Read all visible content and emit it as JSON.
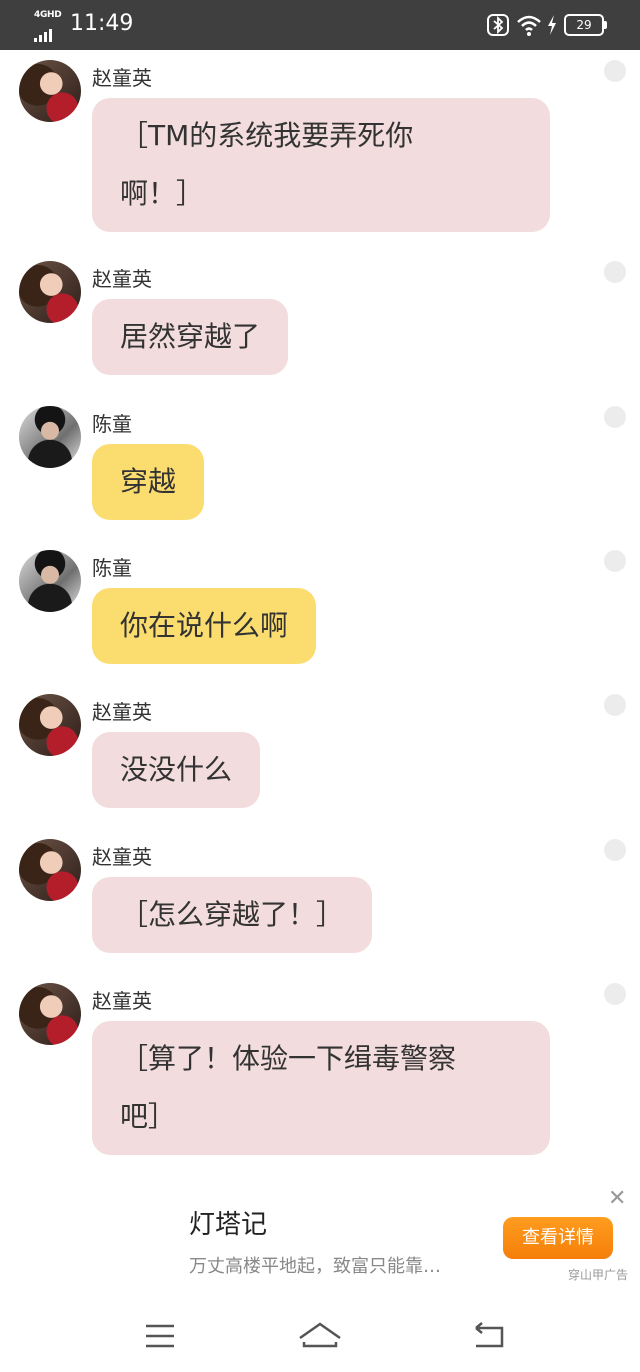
{
  "status_bar": {
    "network": "4GHD",
    "time": "11:49",
    "battery": "29"
  },
  "messages": [
    {
      "sender": "赵童英",
      "text": "［TM的系统我要弄死你啊！］",
      "lines": [
        "［TM的系统我要弄死你",
        "啊！］"
      ]
    },
    {
      "sender": "赵童英",
      "text": "居然穿越了"
    },
    {
      "sender": "陈童",
      "text": "穿越"
    },
    {
      "sender": "陈童",
      "text": "你在说什么啊"
    },
    {
      "sender": "赵童英",
      "text": "没没什么"
    },
    {
      "sender": "赵童英",
      "text": "［怎么穿越了！］"
    },
    {
      "sender": "赵童英",
      "text": "［算了！体验一下缉毒警察吧］",
      "lines": [
        "［算了！体验一下缉毒警察",
        "吧］"
      ]
    }
  ],
  "ad": {
    "title": "灯塔记",
    "description": "万丈高楼平地起，致富只能靠…",
    "button_label": "查看详情",
    "source": "穿山甲广告",
    "close": "✕"
  },
  "colors": {
    "status_bar_bg": "#3f3f3f",
    "pink_bubble": "#f2dcdd",
    "yellow_bubble": "#fbdd6f",
    "ad_button": "#f5870c"
  },
  "icons": {
    "status": [
      "bluetooth-icon",
      "wifi-icon",
      "charging-icon",
      "battery-icon"
    ],
    "nav": [
      "menu-icon",
      "home-icon",
      "back-icon"
    ]
  }
}
